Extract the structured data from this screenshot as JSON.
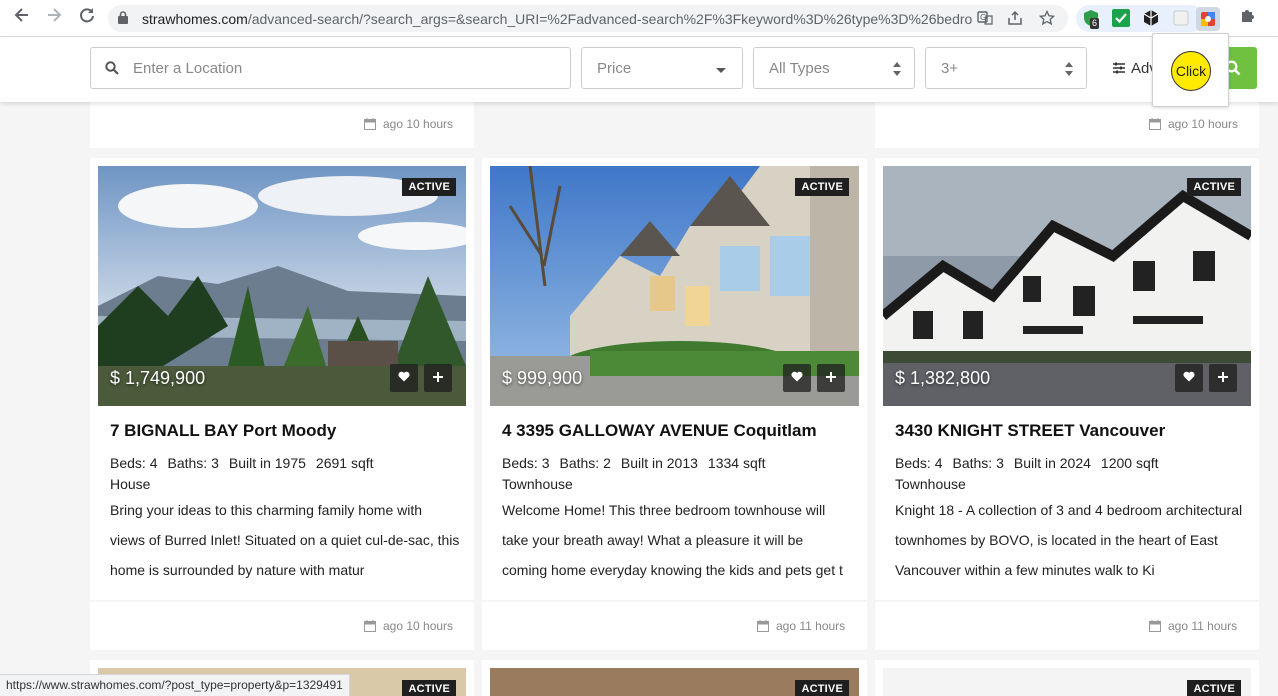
{
  "browser": {
    "url_domain": "strawhomes.com",
    "url_path": "/advanced-search/?search_args=&search_URI=%2Fadvanced-search%2F%3Fkeyword%3D%26type%3D%26bedroo...",
    "extension_badge": "6",
    "status_url": "https://www.strawhomes.com/?post_type=property&p=1329491"
  },
  "search": {
    "location_placeholder": "Enter a Location",
    "price_label": "Price",
    "type_label": "All Types",
    "beds_label": "3+",
    "advanced_label": "Adv",
    "click_label": "Click"
  },
  "top_row": [
    {
      "date": "ago 10 hours"
    },
    {
      "date": "ago 10 hours"
    }
  ],
  "listings": [
    {
      "status": "ACTIVE",
      "price": "$ 1,749,900",
      "title": "7 BIGNALL BAY Port Moody",
      "beds": "Beds: 4",
      "baths": "Baths: 3",
      "built": "Built in 1975",
      "sqft": "2691 sqft",
      "type": "House",
      "description": "Bring your ideas to this charming family home with views of Burred Inlet! Situated on a quiet cul-de-sac, this home is surrounded by nature with matur",
      "date": "ago 10 hours"
    },
    {
      "status": "ACTIVE",
      "price": "$ 999,900",
      "title": "4 3395 GALLOWAY AVENUE Coquitlam",
      "beds": "Beds: 3",
      "baths": "Baths: 2",
      "built": "Built in 2013",
      "sqft": "1334 sqft",
      "type": "Townhouse",
      "description": "Welcome Home! This three bedroom townhouse will take your breath away! What a pleasure it will be coming home everyday knowing the kids and pets get t",
      "date": "ago 11 hours"
    },
    {
      "status": "ACTIVE",
      "price": "$ 1,382,800",
      "title": "3430 KNIGHT STREET Vancouver",
      "beds": "Beds: 4",
      "baths": "Baths: 3",
      "built": "Built in 2024",
      "sqft": "1200 sqft",
      "type": "Townhouse",
      "description": "Knight 18 - A collection of 3 and 4 bedroom architectural townhomes by BOVO, is located in the heart of East Vancouver within a few minutes walk to Ki",
      "date": "ago 11 hours"
    }
  ],
  "next_row": [
    {
      "status": "ACTIVE"
    },
    {
      "status": "ACTIVE"
    },
    {
      "status": "ACTIVE"
    }
  ],
  "colors": {
    "accent_green": "#70c13f",
    "badge_bg": "#1f1f1f",
    "click_highlight": "#ffea00"
  }
}
